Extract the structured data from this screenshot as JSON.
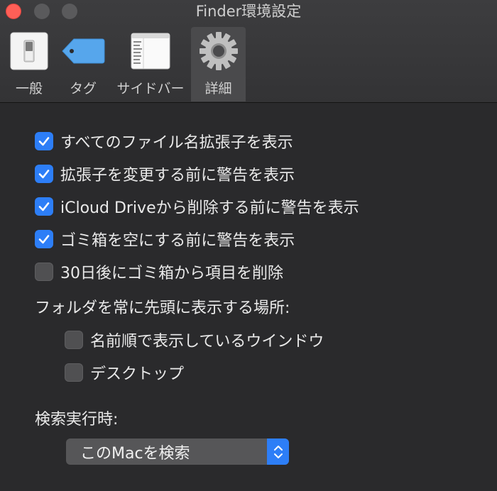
{
  "window": {
    "title": "Finder環境設定"
  },
  "toolbar": {
    "tabs": [
      {
        "label": "一般",
        "icon": "switch-icon"
      },
      {
        "label": "タグ",
        "icon": "tag-icon"
      },
      {
        "label": "サイドバー",
        "icon": "sidebar-list-icon"
      },
      {
        "label": "詳細",
        "icon": "gear-icon",
        "selected": true
      }
    ]
  },
  "options": [
    {
      "label": "すべてのファイル名拡張子を表示",
      "checked": true
    },
    {
      "label": "拡張子を変更する前に警告を表示",
      "checked": true
    },
    {
      "label": "iCloud Driveから削除する前に警告を表示",
      "checked": true
    },
    {
      "label": "ゴミ箱を空にする前に警告を表示",
      "checked": true
    },
    {
      "label": "30日後にゴミ箱から項目を削除",
      "checked": false
    }
  ],
  "folders_on_top": {
    "heading": "フォルダを常に先頭に表示する場所:",
    "options": [
      {
        "label": "名前順で表示しているウインドウ",
        "checked": false
      },
      {
        "label": "デスクトップ",
        "checked": false
      }
    ]
  },
  "search": {
    "heading": "検索実行時:",
    "selected": "このMacを検索"
  },
  "colors": {
    "accent": "#2d7ef7",
    "close": "#ff5f57",
    "background": "#2a2a2c"
  }
}
